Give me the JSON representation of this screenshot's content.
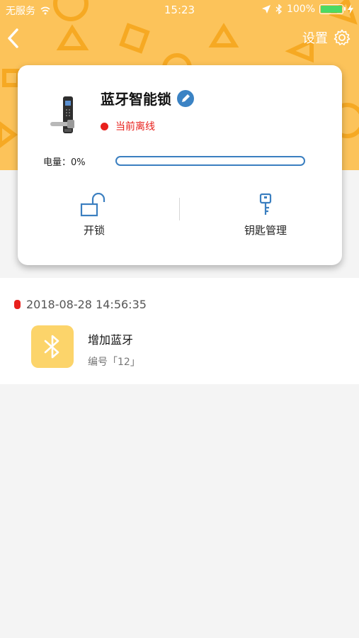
{
  "status_bar": {
    "carrier": "无服务",
    "time": "15:23",
    "battery": "100%"
  },
  "nav": {
    "settings_label": "设置"
  },
  "device": {
    "name": "蓝牙智能锁",
    "status": "当前离线",
    "battery_label": "电量：0%",
    "battery_level": 0
  },
  "actions": {
    "unlock_label": "开锁",
    "key_manage_label": "钥匙管理"
  },
  "log": {
    "time": "2018-08-28 14:56:35",
    "title": "增加蓝牙",
    "subtitle": "编号「12」"
  },
  "colors": {
    "header": "#fcc35a",
    "accent": "#3b7fc0",
    "offline": "#e8201c",
    "bt_tile": "#fcd46a"
  },
  "icons": [
    "wifi-off-icon",
    "location-arrow-icon",
    "bluetooth-icon",
    "battery-icon",
    "charging-icon",
    "back-icon",
    "gear-icon",
    "edit-icon",
    "unlock-icon",
    "key-icon"
  ]
}
